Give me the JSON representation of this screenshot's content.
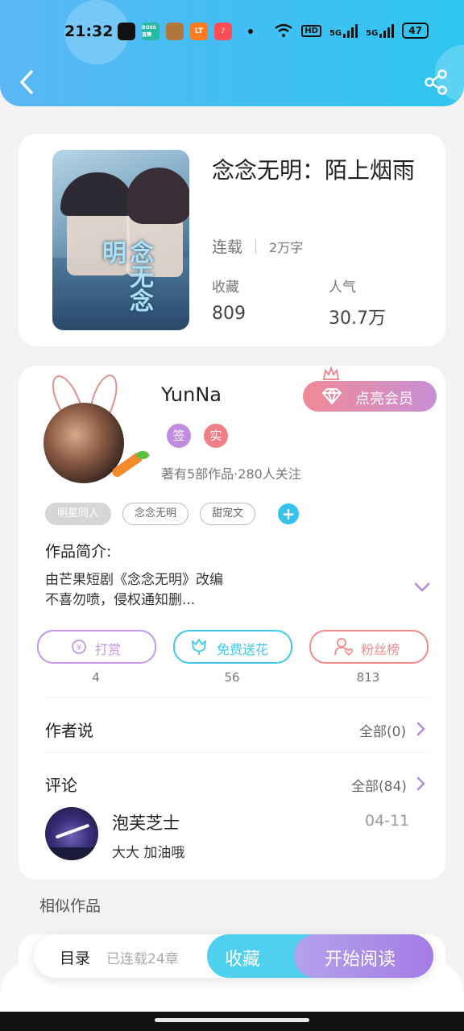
{
  "status_bar": {
    "time": "21:32",
    "app_icons": [
      {
        "name": "wechat-icon",
        "color": "#111111",
        "text": ""
      },
      {
        "name": "boss-zhipin-icon",
        "color": "#28b9a5",
        "text": "BOSS直聘"
      },
      {
        "name": "game-app-icon",
        "color": "#b2753a",
        "text": ""
      },
      {
        "name": "taobao-icon",
        "color": "#ff7a1a",
        "text": "LT"
      },
      {
        "name": "douyin-icon",
        "color": "#ff4d55",
        "text": "♪"
      }
    ],
    "hd_badge": "HD",
    "signal1_label": "5G",
    "signal2_label": "5G",
    "battery": "47"
  },
  "book": {
    "cover_title": "念无念明",
    "title": "念念无明：陌上烟雨",
    "status": "连载",
    "word_count": "2万字",
    "favorites_label": "收藏",
    "favorites_value": "809",
    "popularity_label": "人气",
    "popularity_value": "30.7万"
  },
  "author": {
    "name": "YunNa",
    "vip_button": "点亮会员",
    "badge_sign": "签",
    "badge_real": "实",
    "works_info": "著有5部作品·280人关注",
    "tags": [
      "明星同人",
      "念念无明",
      "甜宠文"
    ],
    "intro_heading": "作品简介:",
    "intro_line1": "由芒果短剧《念念无明》改编",
    "intro_line2": "不喜勿喷，侵权通知删..."
  },
  "actions": [
    {
      "label": "打赏",
      "count": "4",
      "color": "#c597e6"
    },
    {
      "label": "免费送花",
      "count": "56",
      "color": "#3fcbe8"
    },
    {
      "label": "粉丝榜",
      "count": "813",
      "color": "#f28a8c"
    }
  ],
  "author_says": {
    "title": "作者说",
    "all": "全部(0)"
  },
  "comments": {
    "title": "评论",
    "all": "全部(84)",
    "items": [
      {
        "user": "泡芙芝士",
        "text": "大大 加油哦",
        "date": "04-11"
      }
    ]
  },
  "similar": {
    "title": "相似作品"
  },
  "bottom_bar": {
    "catalog": "目录",
    "chapters": "已连载24章",
    "favorite": "收藏",
    "read": "开始阅读"
  }
}
